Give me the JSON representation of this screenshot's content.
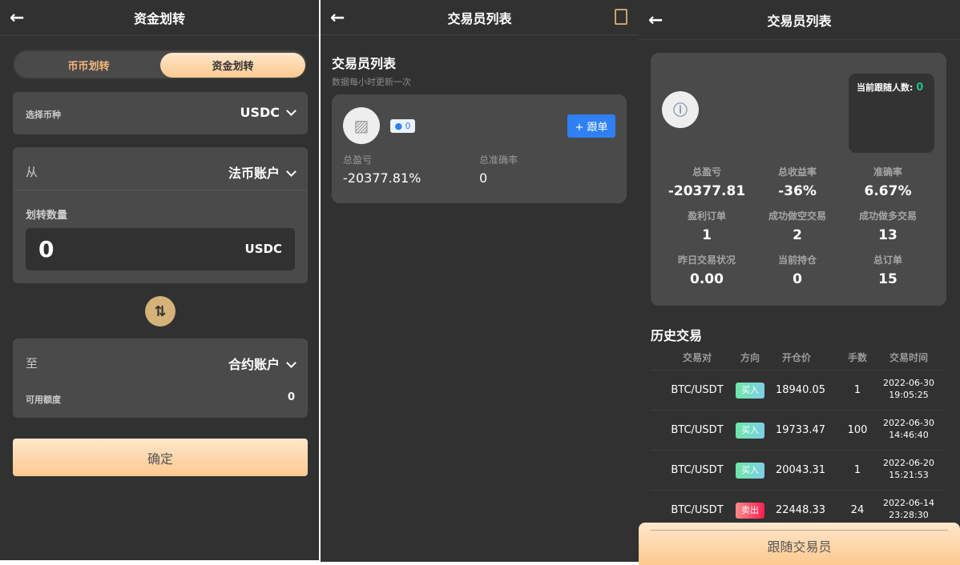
{
  "panel1": {
    "title": "资金划转",
    "tabs": [
      "币币划转",
      "资金划转"
    ],
    "select_coin_label": "选择币种",
    "coin": "USDC",
    "from_label": "从",
    "from_account": "法币账户",
    "amount_label": "划转数量",
    "amount": "0",
    "amount_unit": "USDC",
    "to_label": "至",
    "to_account": "合约账户",
    "available_label": "可用额度",
    "available": "0",
    "confirm": "确定"
  },
  "panel2": {
    "title": "交易员列表",
    "heading": "交易员列表",
    "subtitle": "数据每小时更新一次",
    "followers": "0",
    "follow_btn": "+ 跟单",
    "pnl_label": "总盈亏",
    "pnl": "-20377.81%",
    "acc_label": "总准确率",
    "acc": "0"
  },
  "panel3": {
    "title": "交易员列表",
    "followers_label": "当前跟随人数:",
    "followers": "0",
    "stats": [
      {
        "l": "总盈亏",
        "v": "-20377.81"
      },
      {
        "l": "总收益率",
        "v": "-36%"
      },
      {
        "l": "准确率",
        "v": "6.67%"
      },
      {
        "l": "盈利订单",
        "v": "1"
      },
      {
        "l": "成功做空交易",
        "v": "2"
      },
      {
        "l": "成功做多交易",
        "v": "13"
      },
      {
        "l": "昨日交易状况",
        "v": "0.00"
      },
      {
        "l": "当前持仓",
        "v": "0"
      },
      {
        "l": "总订单",
        "v": "15"
      }
    ],
    "history_title": "历史交易",
    "columns": [
      "交易对",
      "方向",
      "开仓价",
      "手数",
      "交易时间"
    ],
    "rows": [
      {
        "pair": "BTC/USDT",
        "dir": "买入",
        "price": "18940.05",
        "qty": "1",
        "date": "2022-06-30",
        "time": "19:05:25"
      },
      {
        "pair": "BTC/USDT",
        "dir": "买入",
        "price": "19733.47",
        "qty": "100",
        "date": "2022-06-30",
        "time": "14:46:40"
      },
      {
        "pair": "BTC/USDT",
        "dir": "买入",
        "price": "20043.31",
        "qty": "1",
        "date": "2022-06-20",
        "time": "15:21:53"
      },
      {
        "pair": "BTC/USDT",
        "dir": "卖出",
        "price": "22448.33",
        "qty": "24",
        "date": "2022-06-14",
        "time": "23:28:30"
      }
    ],
    "follow_btn": "跟随交易员"
  },
  "colors": {
    "accent": "#fdc98f",
    "blue": "#2f80f5",
    "buy": "#6fe0b8",
    "sell": "#ff1f4f",
    "green": "#1fc08a"
  }
}
